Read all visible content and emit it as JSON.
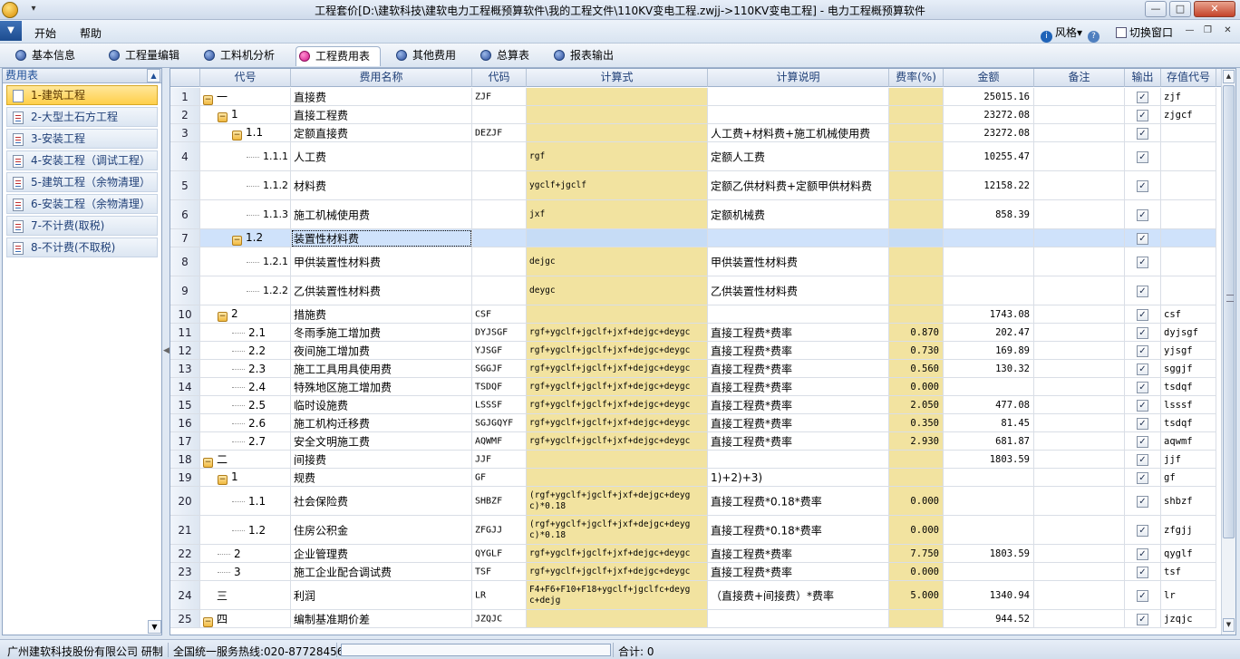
{
  "window": {
    "title": "工程套价[D:\\建软科技\\建软电力工程概预算软件\\我的工程文件\\110KV变电工程.zwjj->110KV变电工程] - 电力工程概预算软件",
    "min_symbol": "—",
    "max_symbol": "□",
    "close_symbol": "✕"
  },
  "menubar": {
    "app_menu_symbol": "▼",
    "items": [
      "开始",
      "帮助"
    ],
    "style_label": "风格",
    "style_arrow": "▾",
    "info_symbol": "i",
    "help_symbol": "?",
    "switch_label": "切换窗口",
    "mini_controls": [
      "—",
      "❐",
      "✕"
    ]
  },
  "tabs": [
    {
      "label": "基本信息",
      "active": false
    },
    {
      "label": "工程量编辑",
      "active": false
    },
    {
      "label": "工料机分析",
      "active": false
    },
    {
      "label": "工程费用表",
      "active": true
    },
    {
      "label": "其他费用",
      "active": false
    },
    {
      "label": "总算表",
      "active": false
    },
    {
      "label": "报表输出",
      "active": false
    }
  ],
  "left_panel": {
    "header": "费用表",
    "items": [
      {
        "label": "1-建筑工程",
        "active": true
      },
      {
        "label": "2-大型土石方工程",
        "active": false
      },
      {
        "label": "3-安装工程",
        "active": false
      },
      {
        "label": "4-安装工程（调试工程）",
        "active": false
      },
      {
        "label": "5-建筑工程（余物清理）",
        "active": false
      },
      {
        "label": "6-安装工程（余物清理）",
        "active": false
      },
      {
        "label": "7-不计费(取税)",
        "active": false
      },
      {
        "label": "8-不计费(不取税)",
        "active": false
      }
    ]
  },
  "grid": {
    "headers": [
      "代号",
      "费用名称",
      "代码",
      "计算式",
      "计算说明",
      "费率(%)",
      "金额",
      "备注",
      "输出",
      "存值代号"
    ],
    "check_symbol": "✓",
    "rows": [
      {
        "num": "1",
        "code": "一",
        "level": 0,
        "node": "toggle",
        "name": "直接费",
        "code2": "ZJF",
        "formula": "",
        "desc": "",
        "rate": "",
        "amount": "25015.16",
        "note": "",
        "output": true,
        "store": "zjf"
      },
      {
        "num": "2",
        "code": "1",
        "level": 1,
        "node": "toggle",
        "name": "直接工程费",
        "code2": "",
        "formula": "",
        "desc": "",
        "rate": "",
        "amount": "23272.08",
        "note": "",
        "output": true,
        "store": "zjgcf"
      },
      {
        "num": "3",
        "code": "1.1",
        "level": 2,
        "node": "toggle",
        "name": "定额直接费",
        "code2": "DEZJF",
        "formula": "",
        "desc": "人工费+材料费+施工机械使用费",
        "rate": "",
        "amount": "23272.08",
        "note": "",
        "output": true,
        "store": ""
      },
      {
        "num": "4",
        "code": "1.1.1",
        "level": 3,
        "node": "leaf",
        "name": "人工费",
        "code2": "",
        "formula": "rgf",
        "desc": "定额人工费",
        "rate": "",
        "amount": "10255.47",
        "note": "",
        "output": true,
        "store": ""
      },
      {
        "num": "5",
        "code": "1.1.2",
        "level": 3,
        "node": "leaf",
        "name": "材料费",
        "code2": "",
        "formula": "ygclf+jgclf",
        "desc": "定额乙供材料费+定额甲供材料费",
        "rate": "",
        "amount": "12158.22",
        "note": "",
        "output": true,
        "store": ""
      },
      {
        "num": "6",
        "code": "1.1.3",
        "level": 3,
        "node": "leaf",
        "name": "施工机械使用费",
        "code2": "",
        "formula": "jxf",
        "desc": "定额机械费",
        "rate": "",
        "amount": "858.39",
        "note": "",
        "output": true,
        "store": ""
      },
      {
        "num": "7",
        "code": "1.2",
        "level": 2,
        "node": "toggle",
        "name": "装置性材料费",
        "code2": "",
        "formula": "",
        "desc": "",
        "rate": "",
        "amount": "",
        "note": "",
        "output": true,
        "store": ""
      },
      {
        "num": "8",
        "code": "1.2.1",
        "level": 3,
        "node": "leaf",
        "name": "甲供装置性材料费",
        "code2": "",
        "formula": "dejgc",
        "desc": "甲供装置性材料费",
        "rate": "",
        "amount": "",
        "note": "",
        "output": true,
        "store": ""
      },
      {
        "num": "9",
        "code": "1.2.2",
        "level": 3,
        "node": "leaf",
        "name": "乙供装置性材料费",
        "code2": "",
        "formula": "deygc",
        "desc": "乙供装置性材料费",
        "rate": "",
        "amount": "",
        "note": "",
        "output": true,
        "store": ""
      },
      {
        "num": "10",
        "code": "2",
        "level": 1,
        "node": "toggle",
        "name": "措施费",
        "code2": "CSF",
        "formula": "",
        "desc": "",
        "rate": "",
        "amount": "1743.08",
        "note": "",
        "output": true,
        "store": "csf"
      },
      {
        "num": "11",
        "code": "2.1",
        "level": 2,
        "node": "leaf",
        "name": "冬雨季施工增加费",
        "code2": "DYJSGF",
        "formula": "rgf+ygclf+jgclf+jxf+dejgc+deygc",
        "desc": "直接工程费*费率",
        "rate": "0.870",
        "amount": "202.47",
        "note": "",
        "output": true,
        "store": "dyjsgf"
      },
      {
        "num": "12",
        "code": "2.2",
        "level": 2,
        "node": "leaf",
        "name": "夜间施工增加费",
        "code2": "YJSGF",
        "formula": "rgf+ygclf+jgclf+jxf+dejgc+deygc",
        "desc": "直接工程费*费率",
        "rate": "0.730",
        "amount": "169.89",
        "note": "",
        "output": true,
        "store": "yjsgf"
      },
      {
        "num": "13",
        "code": "2.3",
        "level": 2,
        "node": "leaf",
        "name": "施工工具用具使用费",
        "code2": "SGGJF",
        "formula": "rgf+ygclf+jgclf+jxf+dejgc+deygc",
        "desc": "直接工程费*费率",
        "rate": "0.560",
        "amount": "130.32",
        "note": "",
        "output": true,
        "store": "sggjf"
      },
      {
        "num": "14",
        "code": "2.4",
        "level": 2,
        "node": "leaf",
        "name": "特殊地区施工增加费",
        "code2": "TSDQF",
        "formula": "rgf+ygclf+jgclf+jxf+dejgc+deygc",
        "desc": "直接工程费*费率",
        "rate": "0.000",
        "amount": "",
        "note": "",
        "output": true,
        "store": "tsdqf"
      },
      {
        "num": "15",
        "code": "2.5",
        "level": 2,
        "node": "leaf",
        "name": "临时设施费",
        "code2": "LSSSF",
        "formula": "rgf+ygclf+jgclf+jxf+dejgc+deygc",
        "desc": "直接工程费*费率",
        "rate": "2.050",
        "amount": "477.08",
        "note": "",
        "output": true,
        "store": "lsssf"
      },
      {
        "num": "16",
        "code": "2.6",
        "level": 2,
        "node": "leaf",
        "name": "施工机构迁移费",
        "code2": "SGJGQYF",
        "formula": "rgf+ygclf+jgclf+jxf+dejgc+deygc",
        "desc": "直接工程费*费率",
        "rate": "0.350",
        "amount": "81.45",
        "note": "",
        "output": true,
        "store": "tsdqf"
      },
      {
        "num": "17",
        "code": "2.7",
        "level": 2,
        "node": "leaf",
        "name": "安全文明施工费",
        "code2": "AQWMF",
        "formula": "rgf+ygclf+jgclf+jxf+dejgc+deygc",
        "desc": "直接工程费*费率",
        "rate": "2.930",
        "amount": "681.87",
        "note": "",
        "output": true,
        "store": "aqwmf"
      },
      {
        "num": "18",
        "code": "二",
        "level": 0,
        "node": "toggle",
        "name": "间接费",
        "code2": "JJF",
        "formula": "",
        "desc": "",
        "rate": "",
        "amount": "1803.59",
        "note": "",
        "output": true,
        "store": "jjf"
      },
      {
        "num": "19",
        "code": "1",
        "level": 1,
        "node": "toggle",
        "name": "规费",
        "code2": "GF",
        "formula": "",
        "desc": "1)+2)+3)",
        "rate": "",
        "amount": "",
        "note": "",
        "output": true,
        "store": "gf"
      },
      {
        "num": "20",
        "code": "1.1",
        "level": 2,
        "node": "leaf",
        "name": "社会保险费",
        "code2": "SHBZF",
        "formula": "(rgf+ygclf+jgclf+jxf+dejgc+deyg\nc)*0.18",
        "desc": "直接工程费*0.18*费率",
        "rate": "0.000",
        "amount": "",
        "note": "",
        "output": true,
        "store": "shbzf"
      },
      {
        "num": "21",
        "code": "1.2",
        "level": 2,
        "node": "leaf",
        "name": "住房公积金",
        "code2": "ZFGJJ",
        "formula": "(rgf+ygclf+jgclf+jxf+dejgc+deyg\nc)*0.18",
        "desc": "直接工程费*0.18*费率",
        "rate": "0.000",
        "amount": "",
        "note": "",
        "output": true,
        "store": "zfgjj"
      },
      {
        "num": "22",
        "code": "2",
        "level": 1,
        "node": "leaf",
        "name": "企业管理费",
        "code2": "QYGLF",
        "formula": "rgf+ygclf+jgclf+jxf+dejgc+deygc",
        "desc": "直接工程费*费率",
        "rate": "7.750",
        "amount": "1803.59",
        "note": "",
        "output": true,
        "store": "qyglf"
      },
      {
        "num": "23",
        "code": "3",
        "level": 1,
        "node": "leaf",
        "name": "施工企业配合调试费",
        "code2": "TSF",
        "formula": "rgf+ygclf+jgclf+jxf+dejgc+deygc",
        "desc": "直接工程费*费率",
        "rate": "0.000",
        "amount": "",
        "note": "",
        "output": true,
        "store": "tsf"
      },
      {
        "num": "24",
        "code": "三",
        "level": 0,
        "node": "none",
        "name": "利润",
        "code2": "LR",
        "formula": "F4+F6+F10+F18+ygclf+jgclfc+deyg\nc+dejg",
        "desc": "（直接费+间接费）*费率",
        "rate": "5.000",
        "amount": "1340.94",
        "note": "",
        "output": true,
        "store": "lr"
      },
      {
        "num": "25",
        "code": "四",
        "level": 0,
        "node": "toggle",
        "name": "编制基准期价差",
        "code2": "JZQJC",
        "formula": "",
        "desc": "",
        "rate": "",
        "amount": "944.52",
        "note": "",
        "output": true,
        "store": "jzqjc"
      }
    ]
  },
  "statusbar": {
    "company": "广州建软科技股份有限公司 研制",
    "hotline": "全国统一服务热线:020-87728456",
    "total": "合计: 0"
  }
}
